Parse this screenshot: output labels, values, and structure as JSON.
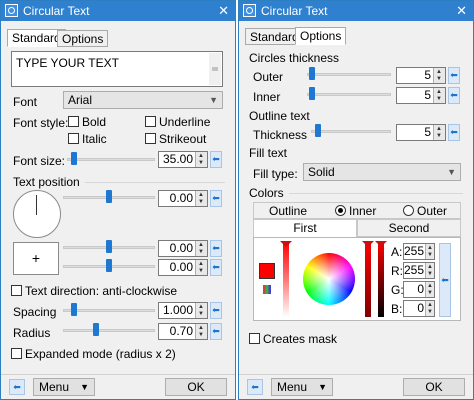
{
  "left": {
    "title": "Circular Text",
    "close": "✕",
    "tabs": [
      "Standard",
      "Options"
    ],
    "text_value": "TYPE YOUR TEXT",
    "font_label": "Font",
    "font_value": "Arial",
    "font_style_label": "Font style:",
    "bold": "Bold",
    "underline": "Underline",
    "italic": "Italic",
    "strikeout": "Strikeout",
    "font_size_label": "Font size:",
    "font_size_value": "35.00",
    "text_position_label": "Text position",
    "angle_value": "0.00",
    "x_value": "0.00",
    "y_value": "0.00",
    "plus": "+",
    "direction_label": "Text direction: anti-clockwise",
    "spacing_label": "Spacing",
    "spacing_value": "1.000",
    "radius_label": "Radius",
    "radius_value": "0.70",
    "expanded_label": "Expanded mode (radius x 2)",
    "menu_label": "Menu",
    "ok_label": "OK"
  },
  "right": {
    "title": "Circular Text",
    "close": "✕",
    "tabs": [
      "Standard",
      "Options"
    ],
    "circles_label": "Circles thickness",
    "outer_label": "Outer",
    "outer_value": "5",
    "inner_label": "Inner",
    "inner_value": "5",
    "outline_text_label": "Outline text",
    "thickness_label": "Thickness",
    "thickness_value": "5",
    "fill_text_label": "Fill text",
    "fill_type_label": "Fill type:",
    "fill_type_value": "Solid",
    "colors_label": "Colors",
    "color_tabs": [
      "Outline",
      "Inner",
      "Outer"
    ],
    "sub_tabs": [
      "First",
      "Second"
    ],
    "a_label": "A:",
    "a_value": "255",
    "r_label": "R:",
    "r_value": "255",
    "g_label": "G:",
    "g_value": "0",
    "b_label": "B:",
    "b_value": "0",
    "mask_label": "Creates mask",
    "menu_label": "Menu",
    "ok_label": "OK"
  },
  "colors": {
    "title_bar": "#2f80cf",
    "swatch": "#ff0000",
    "slider_thumb": "#1e78d2"
  }
}
